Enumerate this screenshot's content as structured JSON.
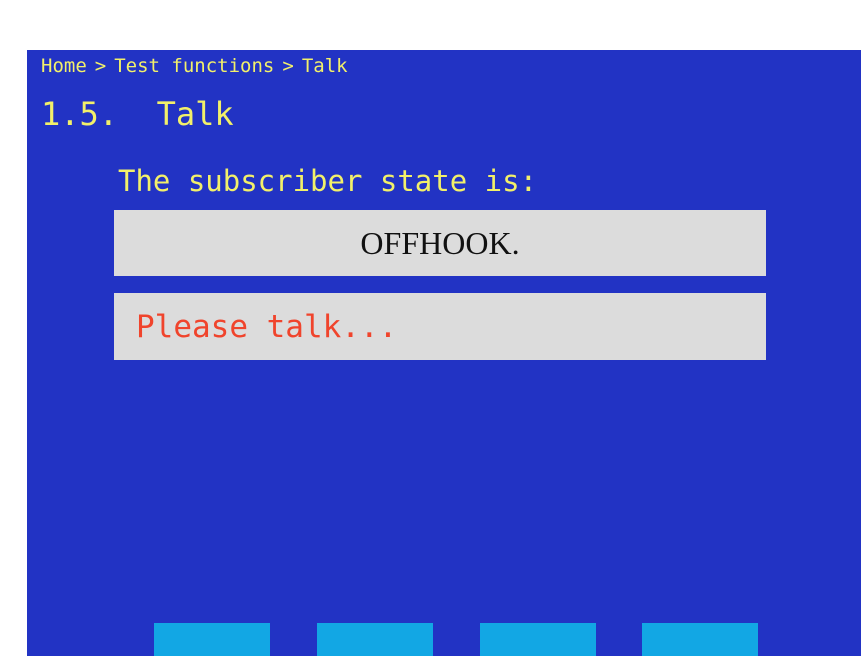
{
  "breadcrumb": {
    "items": [
      "Home",
      "Test functions",
      "Talk"
    ],
    "separator": ">"
  },
  "page": {
    "title": "1.5.  Talk"
  },
  "status": {
    "label": "The subscriber state is:",
    "value": "OFFHOOK.",
    "message": "Please talk..."
  },
  "colors": {
    "background": "#2233c4",
    "heading_text": "#f2f06a",
    "box_background": "#dcdcdc",
    "state_text": "#111111",
    "message_text": "#f0442c",
    "softkey": "#12a7e4"
  },
  "softkeys": [
    {
      "label": ""
    },
    {
      "label": ""
    },
    {
      "label": ""
    },
    {
      "label": ""
    }
  ]
}
